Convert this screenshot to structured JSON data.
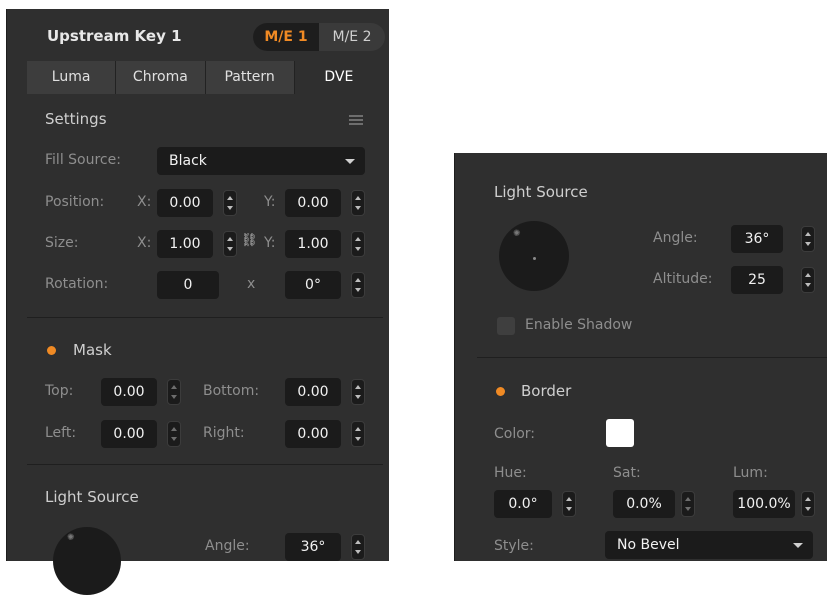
{
  "left": {
    "header": {
      "title": "Upstream Key 1",
      "me_options": [
        "M/E 1",
        "M/E 2"
      ],
      "me_active": "M/E 1"
    },
    "tabs": [
      "Luma",
      "Chroma",
      "Pattern",
      "DVE"
    ],
    "active_tab": "DVE",
    "settings": {
      "title": "Settings",
      "fill_source_label": "Fill Source:",
      "fill_source_value": "Black",
      "position_label": "Position:",
      "x_label": "X:",
      "y_label": "Y:",
      "position_x": "0.00",
      "position_y": "0.00",
      "size_label": "Size:",
      "size_x": "1.00",
      "size_y": "1.00",
      "rotation_label": "Rotation:",
      "rotation_turns": "0",
      "rotation_x": "x",
      "rotation_degrees": "0°"
    },
    "mask": {
      "title": "Mask",
      "top_label": "Top:",
      "top_value": "0.00",
      "bottom_label": "Bottom:",
      "bottom_value": "0.00",
      "left_label": "Left:",
      "left_value": "0.00",
      "right_label": "Right:",
      "right_value": "0.00"
    },
    "light_source": {
      "title": "Light Source",
      "angle_label": "Angle:",
      "angle_value": "36°"
    }
  },
  "right": {
    "light_source": {
      "title": "Light Source",
      "angle_label": "Angle:",
      "angle_value": "36°",
      "altitude_label": "Altitude:",
      "altitude_value": "25",
      "enable_shadow_label": "Enable Shadow"
    },
    "border": {
      "title": "Border",
      "color_label": "Color:",
      "color_value": "#ffffff",
      "hue_label": "Hue:",
      "hue_value": "0.0°",
      "sat_label": "Sat:",
      "sat_value": "0.0%",
      "lum_label": "Lum:",
      "lum_value": "100.0%",
      "style_label": "Style:",
      "style_value": "No Bevel"
    }
  },
  "colors": {
    "accent": "#f08a24",
    "panel": "#2f2f2f",
    "field": "#1b1b1b"
  }
}
